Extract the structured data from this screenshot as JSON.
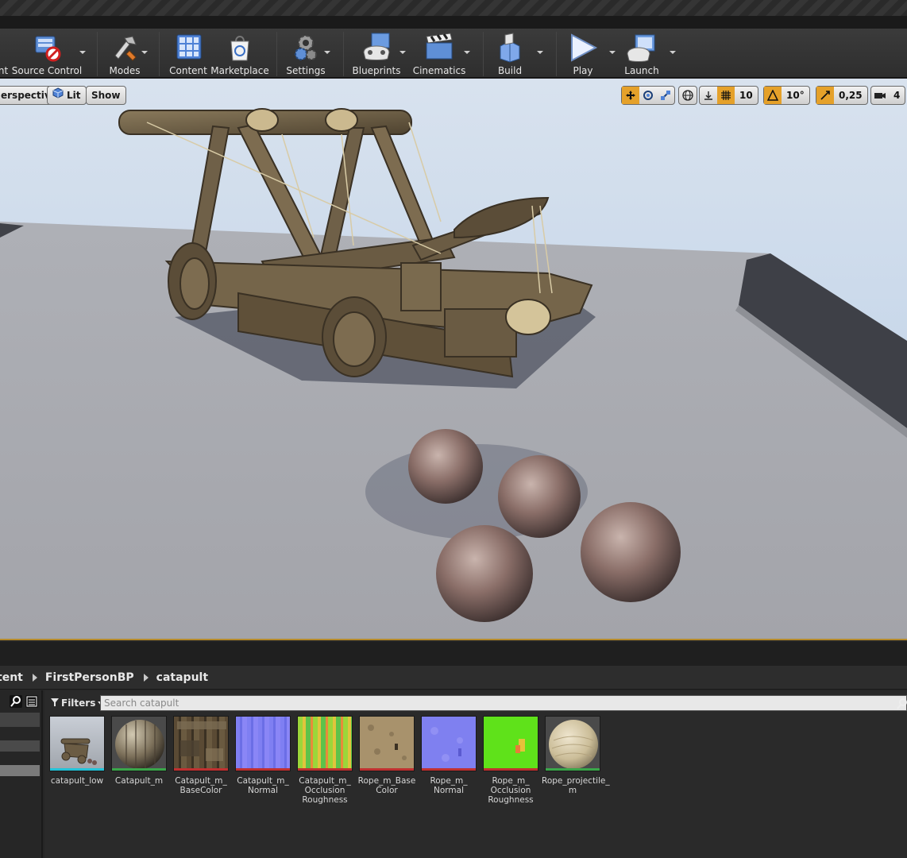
{
  "toolbar": {
    "items": [
      {
        "label": "nt",
        "icon": "save-icon"
      },
      {
        "label": "Source Control",
        "icon": "source-control-icon"
      },
      {
        "label": "Modes",
        "icon": "modes-icon"
      },
      {
        "label": "Content",
        "icon": "content-icon"
      },
      {
        "label": "Marketplace",
        "icon": "marketplace-icon"
      },
      {
        "label": "Settings",
        "icon": "settings-icon"
      },
      {
        "label": "Blueprints",
        "icon": "blueprints-icon"
      },
      {
        "label": "Cinematics",
        "icon": "cinematics-icon"
      },
      {
        "label": "Build",
        "icon": "build-icon"
      },
      {
        "label": "Play",
        "icon": "play-icon"
      },
      {
        "label": "Launch",
        "icon": "launch-icon"
      }
    ]
  },
  "viewport": {
    "view_mode": "erspective",
    "lit_label": "Lit",
    "show_label": "Show",
    "grid_snap": "10",
    "rotation_snap": "10°",
    "scale_snap": "0,25",
    "camera_speed": "4"
  },
  "path": {
    "items": [
      "tent",
      "FirstPersonBP",
      "catapult"
    ]
  },
  "content_browser": {
    "filters_label": "Filters",
    "search_placeholder": "Search catapult",
    "assets": [
      {
        "label": "catapult_low",
        "type": "mesh",
        "strip": "#23c3d8"
      },
      {
        "label": "Catapult_m",
        "type": "material",
        "strip": "#3aa64a"
      },
      {
        "label": "Catapult_m_ BaseColor",
        "type": "texture",
        "strip": "#c03030"
      },
      {
        "label": "Catapult_m_ Normal",
        "type": "texture",
        "strip": "#c03030"
      },
      {
        "label": "Catapult_m_ Occlusion Roughness",
        "type": "texture",
        "strip": "#c03030"
      },
      {
        "label": "Rope_m_Base Color",
        "type": "texture",
        "strip": "#c03030"
      },
      {
        "label": "Rope_m_ Normal",
        "type": "texture",
        "strip": "#c03030"
      },
      {
        "label": "Rope_m_ Occlusion Roughness",
        "type": "texture",
        "strip": "#c03030"
      },
      {
        "label": "Rope_projectile_ m",
        "type": "material",
        "strip": "#3aa64a"
      }
    ]
  },
  "colors": {
    "accent": "#e5a12a",
    "viewport_border": "#b58a2b"
  }
}
